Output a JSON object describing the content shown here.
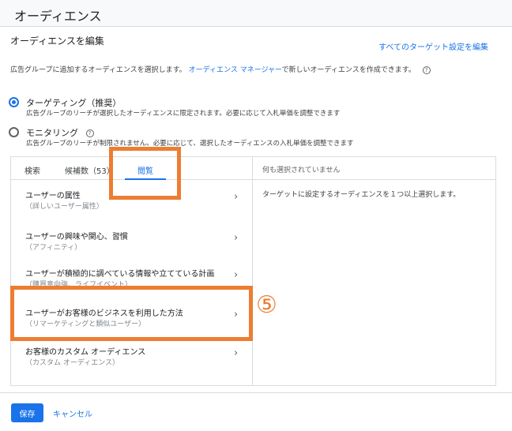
{
  "header": {
    "title": "オーディエンス"
  },
  "section": {
    "title": "オーディエンスを編集",
    "edit_all_link": "すべてのターゲット設定を編集"
  },
  "description": {
    "before": "広告グループに追加するオーディエンスを選択します。",
    "link": "オーディエンス マネージャー",
    "after": "で新しいオーディエンスを作成できます。",
    "help_icon": "?"
  },
  "targeting_options": [
    {
      "label": "ターゲティング（推奨）",
      "desc": "広告グループのリーチが選択したオーディエンスに限定されます。必要に応じて入札単価を調整できます",
      "checked": true
    },
    {
      "label": "モニタリング",
      "desc": "広告グループのリーチが制限されません。必要に応じて、選択したオーディエンスの入札単価を調整できます",
      "checked": false
    }
  ],
  "tabs": [
    {
      "label": "検索"
    },
    {
      "label": "候補数（53）"
    },
    {
      "label": "閲覧",
      "active": true
    }
  ],
  "browse_items": [
    {
      "title": "ユーザーの属性",
      "sub": "（詳しいユーザー属性）"
    },
    {
      "title": "ユーザーの興味や関心、習慣",
      "sub": "（アフィニティ）"
    },
    {
      "title": "ユーザーが積極的に調べている情報や立てている計画",
      "sub": "（購買意向強、ライフイベント）"
    },
    {
      "title": "ユーザーがお客様のビジネスを利用した方法",
      "sub": "（リマーケティングと類似ユーザー）"
    },
    {
      "title": "お客様のカスタム オーディエンス",
      "sub": "（カスタム オーディエンス）"
    }
  ],
  "selection_panel": {
    "header": "何も選択されていません",
    "hint": "ターゲットに設定するオーディエンスを１つ以上選択します。"
  },
  "annotation": {
    "step_marker": "⑤",
    "color": "#ed7d31"
  },
  "footer": {
    "save_label": "保存",
    "cancel_label": "キャンセル"
  },
  "colors": {
    "accent": "#1a73e8",
    "highlight": "#ed7d31"
  }
}
